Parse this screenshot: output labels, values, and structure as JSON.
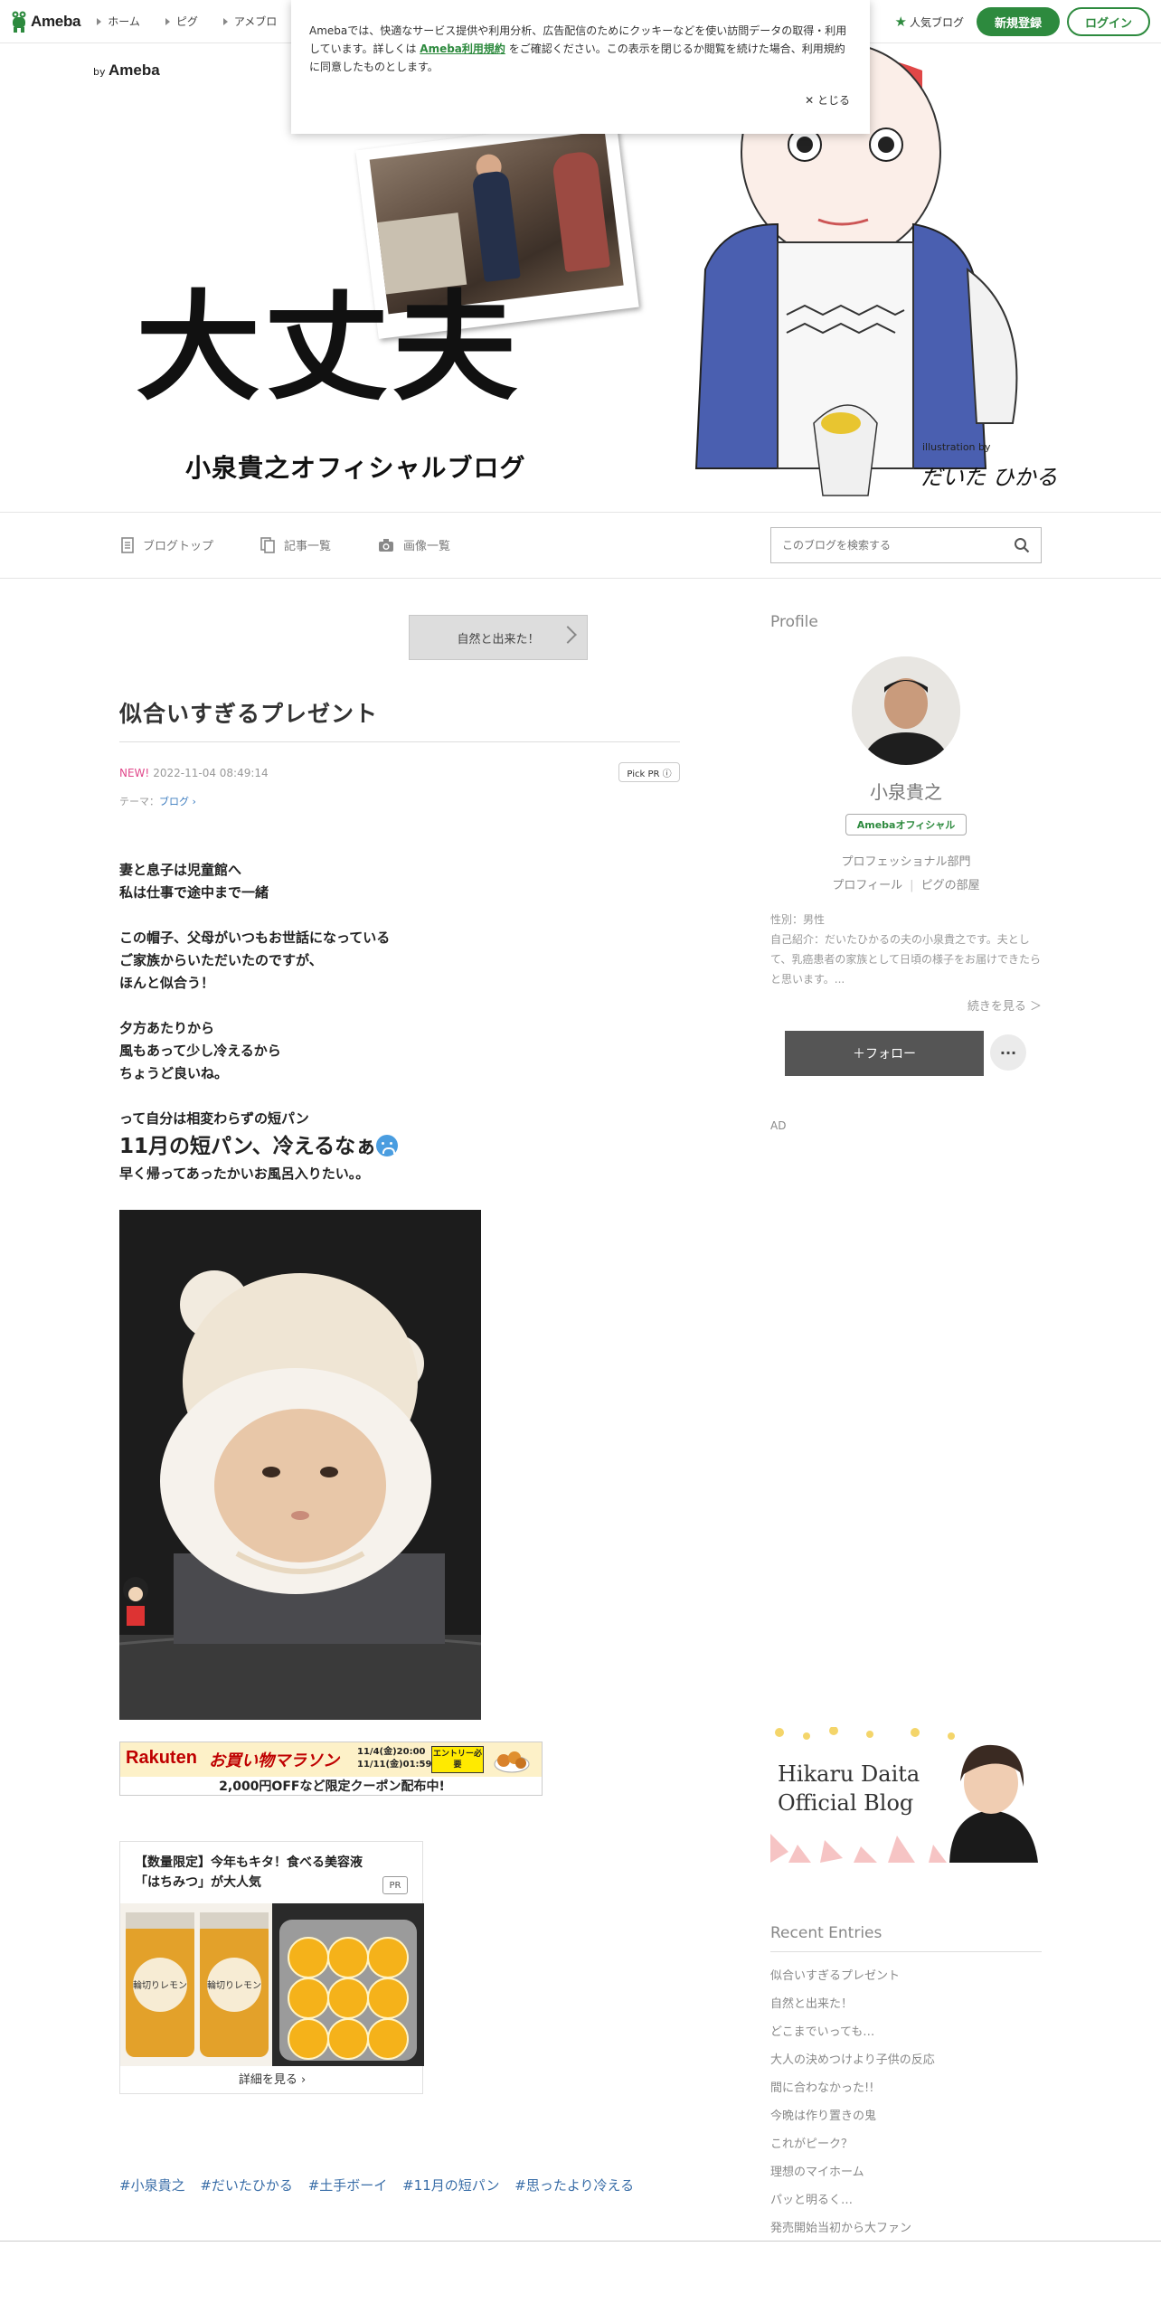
{
  "topbar": {
    "brand": "Ameba",
    "nav": [
      "ホーム",
      "ピグ",
      "アメブロ"
    ],
    "popular": "人気ブログ",
    "register": "新規登録",
    "login": "ログイン"
  },
  "cookie": {
    "text_before": "Amebaでは、快適なサービス提供や利用分析、広告配信のためにクッキーなどを使い訪問データの取得・利用しています。詳しくは",
    "link": "Ameba利用規約",
    "text_after": "をご確認ください。この表示を閉じるか閲覧を続けた場合、利用規約に同意したものとします。",
    "close": "✕ とじる"
  },
  "header": {
    "by": "by",
    "brand": "Ameba",
    "title": "大丈夫",
    "subtitle": "小泉貴之オフィシャルブログ",
    "illustration_by": "illustration by",
    "illustrator": "だいた ひかる"
  },
  "blognav": {
    "items": [
      "ブログトップ",
      "記事一覧",
      "画像一覧"
    ],
    "search_placeholder": "このブログを検索する"
  },
  "entry": {
    "prev_label": "自然と出来た！",
    "title": "似合いすぎるプレゼント",
    "new_badge": "NEW!",
    "datetime": "2022-11-04 08:49:14",
    "pick_pr": "Pick PR ⓘ",
    "theme_label": "テーマ：",
    "theme": "ブログ ›",
    "body": [
      "妻と息子は児童館へ",
      "私は仕事で途中まで一緒",
      "",
      "この帽子、父母がいつもお世話になっている",
      "ご家族からいただいたのですが、",
      "ほんと似合う！",
      "",
      "夕方あたりから",
      "風もあって少し冷えるから",
      "ちょうど良いね。",
      "",
      "って自分は相変わらずの短パン"
    ],
    "big_line": "11月の短パン、冷えるなぁ",
    "after_line": "早く帰ってあったかいお風呂入りたい。。",
    "hashtags": [
      "#小泉貴之",
      "#だいたひかる",
      "#土手ボーイ",
      "#11月の短パン",
      "#思ったより冷える"
    ]
  },
  "rakuten": {
    "logo": "Rakuten",
    "event": "お買い物マラソン",
    "date1": "11/4(金)20:00",
    "date2": "11/11(金)01:59",
    "entry": "エントリー必要",
    "bottom": "2,000円OFFなど限定クーポン配布中!"
  },
  "pr_card": {
    "title": "【数量限定】今年もキタ！食べる美容液「はちみつ」が大人気",
    "tag": "PR",
    "jar_label": "輪切りレモン",
    "more": "詳細を見る ›"
  },
  "sidebar": {
    "profile_heading": "Profile",
    "name": "小泉貴之",
    "official": "Amebaオフィシャル",
    "category": "プロフェッショナル部門",
    "links": [
      "プロフィール",
      "ピグの部屋"
    ],
    "gender": "性別：男性",
    "intro": "自己紹介：だいたひかるの夫の小泉貴之です。夫として、乳癌患者の家族として日頃の様子をお届けできたらと思います。...",
    "readmore": "続きを見る ＞",
    "follow": "＋フォロー",
    "more": "···",
    "ad": "AD",
    "hikaru_banner": [
      "Hikaru Daita",
      "Official Blog"
    ],
    "recent_heading": "Recent Entries",
    "recent": [
      "似合いすぎるプレゼント",
      "自然と出来た！",
      "どこまでいっても…",
      "大人の決めつけより子供の反応",
      "間に合わなかった!!",
      "今晩は作り置きの鬼",
      "これがピーク？",
      "理想のマイホーム",
      "パッと明るく…",
      "発売開始当初から大ファン"
    ]
  },
  "colors": {
    "brand_green": "#2d8a3e",
    "new_pink": "#e0478a",
    "link_blue": "#3a7bbf",
    "rakuten_red": "#bf0000"
  }
}
